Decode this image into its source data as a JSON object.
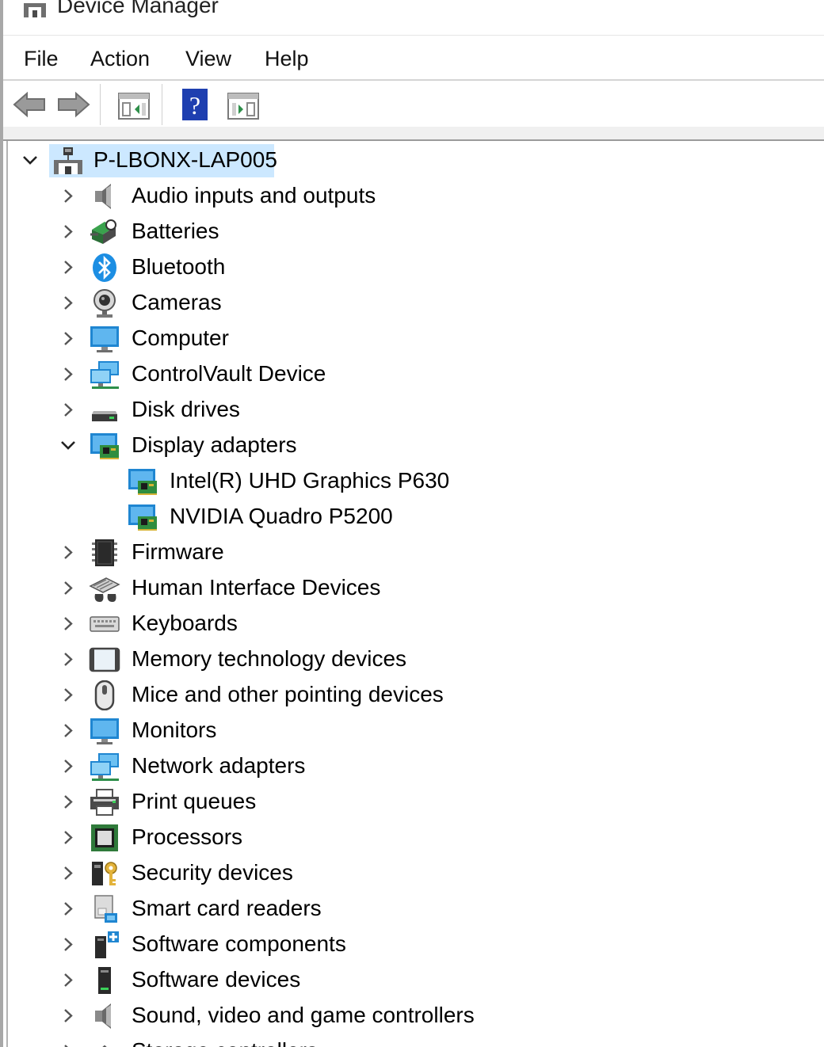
{
  "window": {
    "title": "Device Manager"
  },
  "menu": [
    "File",
    "Action",
    "View",
    "Help"
  ],
  "toolbar": [
    {
      "icon": "back-arrow-icon"
    },
    {
      "icon": "forward-arrow-icon"
    },
    {
      "icon": "show-hide-console-tree-icon"
    },
    {
      "icon": "help-icon"
    },
    {
      "icon": "show-hide-action-pane-icon"
    }
  ],
  "tree": {
    "root": {
      "label": "P-LBONX-LAP005",
      "expanded": true,
      "selected": true
    },
    "items": [
      {
        "label": "Audio inputs and outputs",
        "icon": "speaker"
      },
      {
        "label": "Batteries",
        "icon": "battery"
      },
      {
        "label": "Bluetooth",
        "icon": "bluetooth"
      },
      {
        "label": "Cameras",
        "icon": "camera"
      },
      {
        "label": "Computer",
        "icon": "monitor"
      },
      {
        "label": "ControlVault Device",
        "icon": "network"
      },
      {
        "label": "Disk drives",
        "icon": "disk"
      },
      {
        "label": "Display adapters",
        "icon": "display-adapter",
        "expanded": true,
        "children": [
          {
            "label": "Intel(R) UHD Graphics P630",
            "icon": "display-adapter"
          },
          {
            "label": "NVIDIA Quadro P5200",
            "icon": "display-adapter"
          }
        ]
      },
      {
        "label": "Firmware",
        "icon": "chip"
      },
      {
        "label": "Human Interface Devices",
        "icon": "hid"
      },
      {
        "label": "Keyboards",
        "icon": "keyboard"
      },
      {
        "label": "Memory technology devices",
        "icon": "memory"
      },
      {
        "label": "Mice and other pointing devices",
        "icon": "mouse"
      },
      {
        "label": "Monitors",
        "icon": "monitor"
      },
      {
        "label": "Network adapters",
        "icon": "network"
      },
      {
        "label": "Print queues",
        "icon": "printer"
      },
      {
        "label": "Processors",
        "icon": "processor"
      },
      {
        "label": "Security devices",
        "icon": "security"
      },
      {
        "label": "Smart card readers",
        "icon": "smartcard"
      },
      {
        "label": "Software components",
        "icon": "software-component"
      },
      {
        "label": "Software devices",
        "icon": "software-device"
      },
      {
        "label": "Sound, video and game controllers",
        "icon": "speaker"
      },
      {
        "label": "Storage controllers",
        "icon": "storage"
      }
    ]
  },
  "colors": {
    "selection": "#cce8ff",
    "toolbar_divider": "#d0d0d0",
    "help_blue": "#1e3fb0"
  }
}
